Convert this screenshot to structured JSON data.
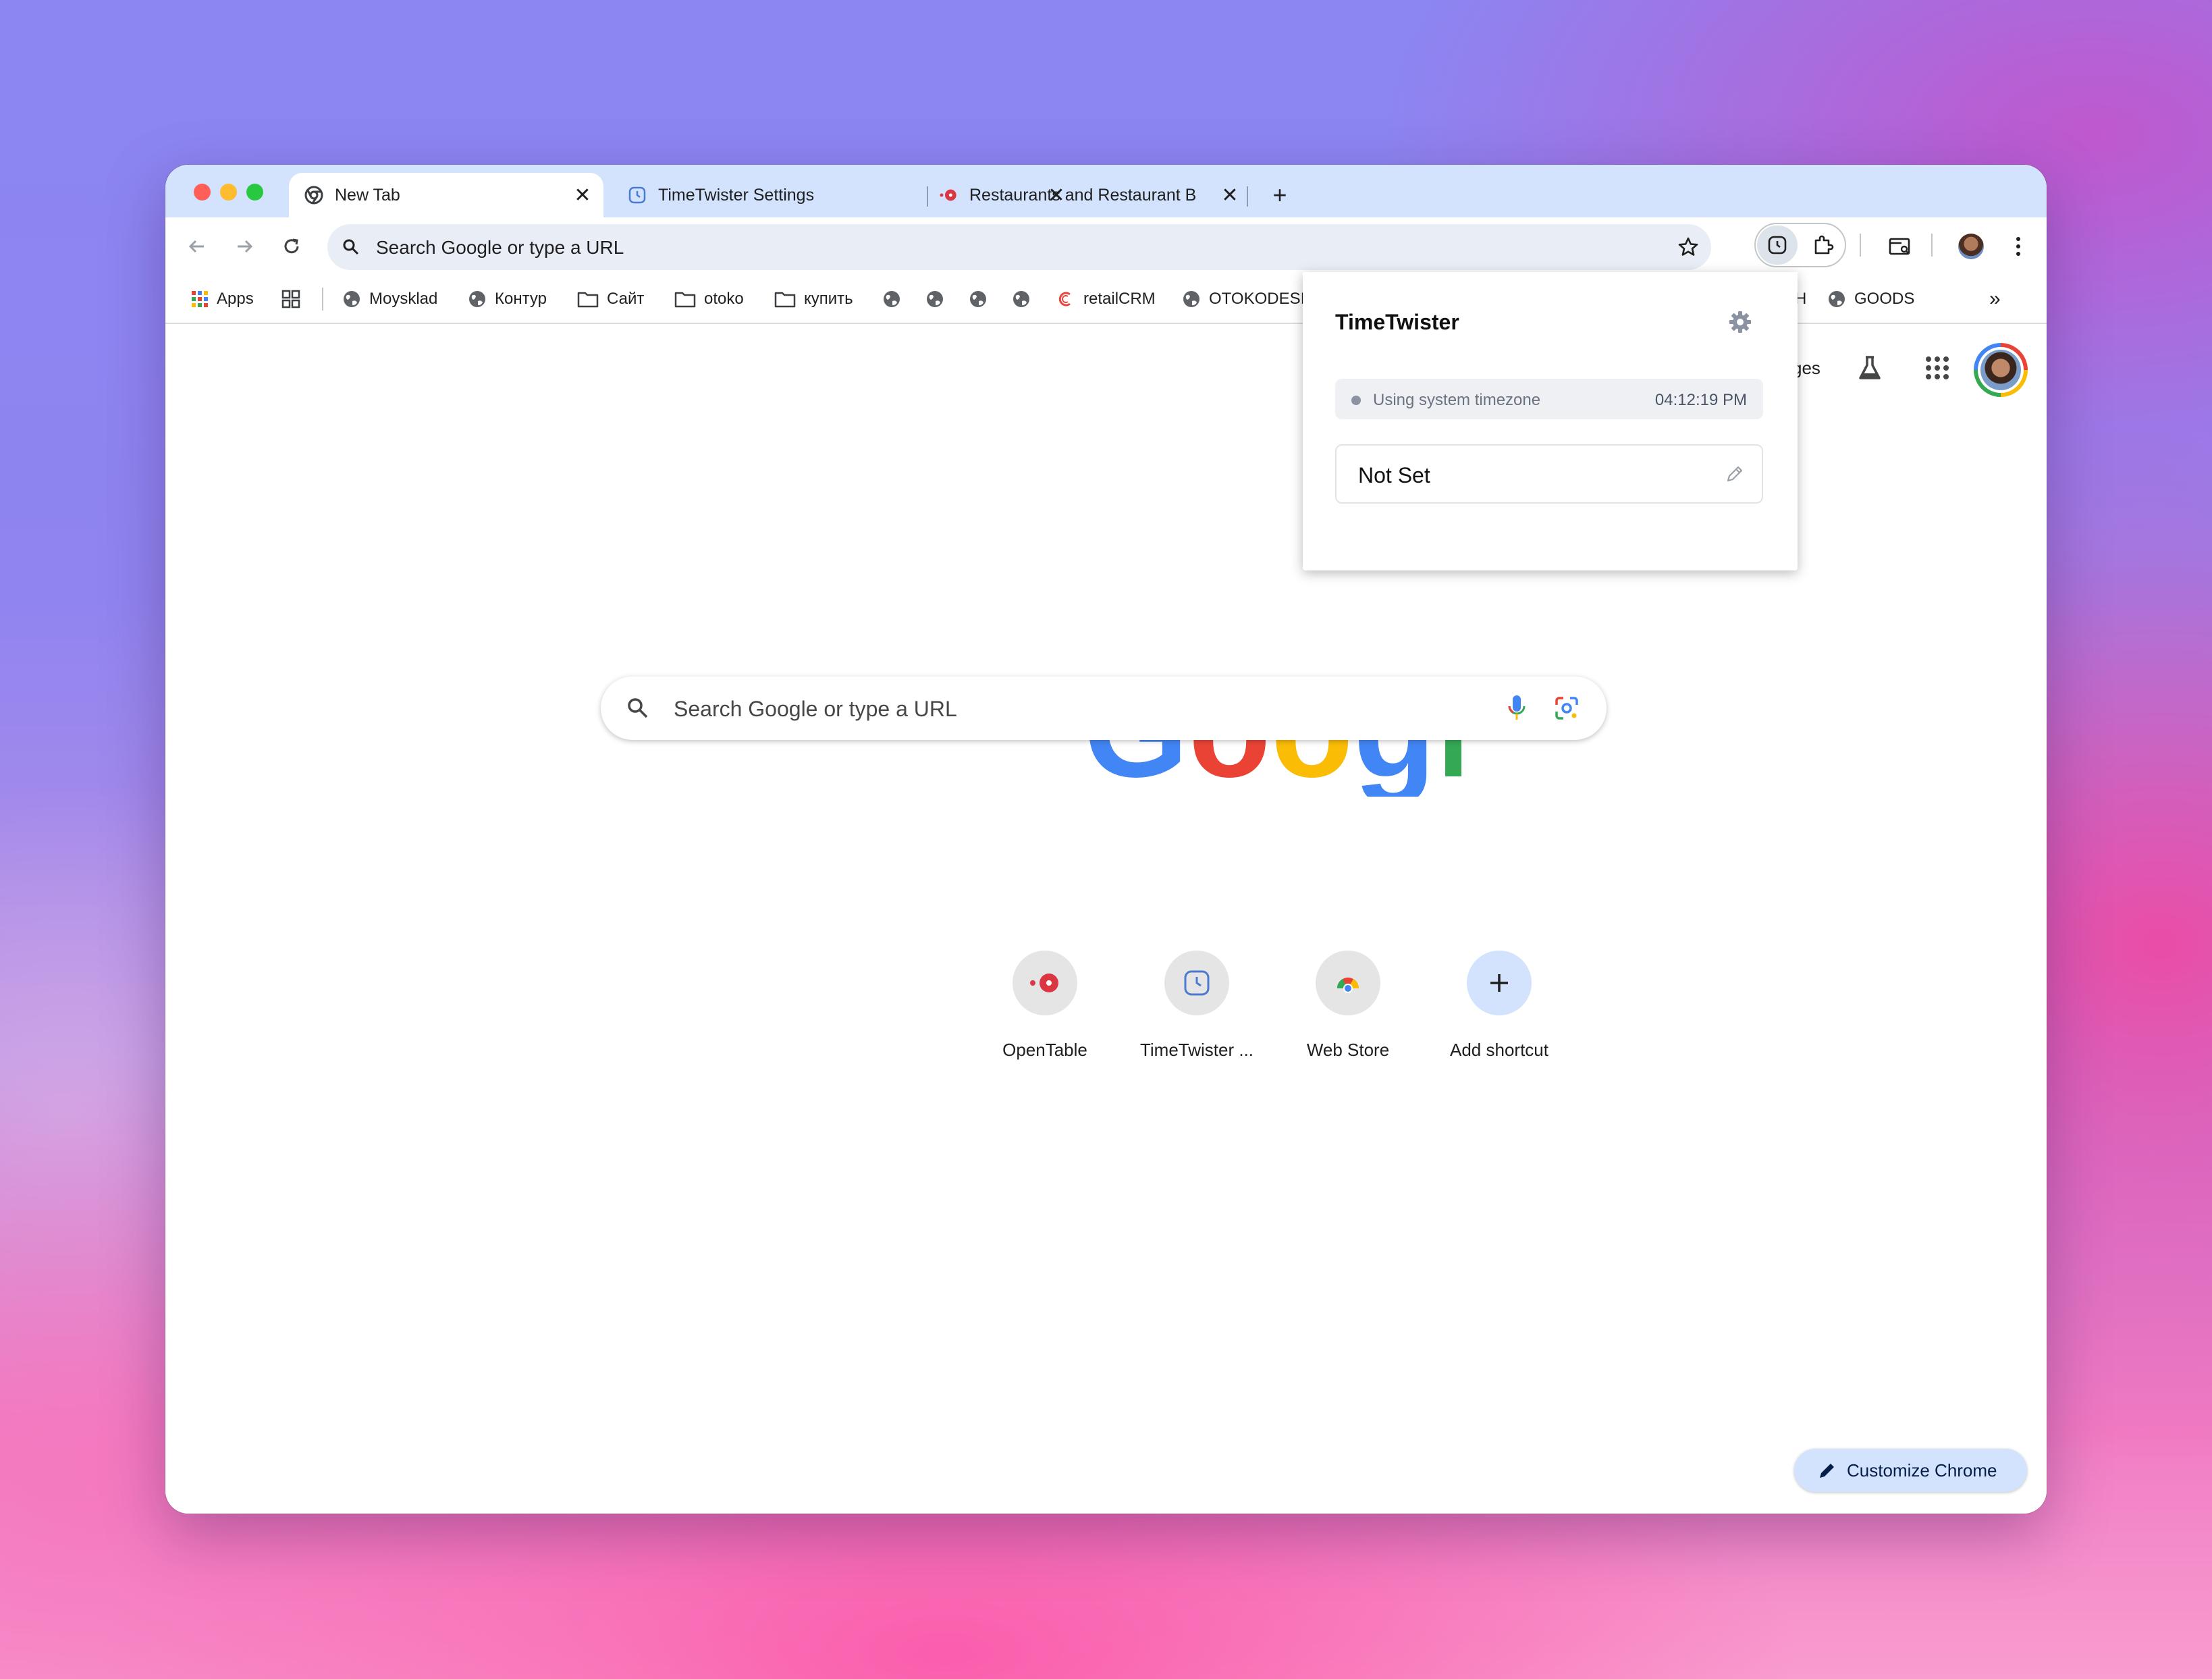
{
  "tabs": [
    {
      "label": "New Tab",
      "icon": "chrome-icon",
      "active": true
    },
    {
      "label": "TimeTwister Settings",
      "icon": "timetwister-icon",
      "active": false
    },
    {
      "label": "Restaurants and Restaurant B",
      "icon": "opentable-icon",
      "active": false
    }
  ],
  "omnibox": {
    "text": "Search Google or type a URL"
  },
  "bookmarks": [
    {
      "label": "Apps",
      "icon": "apps-grid-icon"
    },
    {
      "label": "",
      "icon": "tab-groups-icon"
    },
    {
      "label": "Moysklad",
      "icon": "globe-icon"
    },
    {
      "label": "Контур",
      "icon": "globe-icon"
    },
    {
      "label": "Сайт",
      "icon": "folder-icon"
    },
    {
      "label": "otoko",
      "icon": "folder-icon"
    },
    {
      "label": "купить",
      "icon": "folder-icon"
    },
    {
      "label": "",
      "icon": "globe-icon"
    },
    {
      "label": "",
      "icon": "globe-icon"
    },
    {
      "label": "",
      "icon": "globe-icon"
    },
    {
      "label": "",
      "icon": "globe-icon"
    },
    {
      "label": "retailCRM",
      "icon": "retailcrm-icon"
    },
    {
      "label": "OTOKODESI",
      "icon": "globe-icon"
    },
    {
      "label": "H",
      "icon": ""
    },
    {
      "label": "GOODS",
      "icon": "globe-icon"
    }
  ],
  "ntp": {
    "header_partial": "ges",
    "search_placeholder": "Search Google or type a URL",
    "shortcuts": [
      {
        "label": "OpenTable",
        "icon": "opentable-icon"
      },
      {
        "label": "TimeTwister ...",
        "icon": "timetwister-icon"
      },
      {
        "label": "Web Store",
        "icon": "webstore-icon"
      },
      {
        "label": "Add shortcut",
        "icon": "plus-icon"
      }
    ],
    "customize_label": "Customize Chrome"
  },
  "popup": {
    "title": "TimeTwister",
    "status_text": "Using system timezone",
    "time": "04:12:19 PM",
    "timezone_value": "Not Set"
  },
  "colors": {
    "google_blue": "#4285F4",
    "google_red": "#EA4335",
    "google_yellow": "#FBBC05",
    "google_green": "#34A853",
    "tabstrip": "#d3e3fd",
    "omnibox": "#e9eef6"
  }
}
